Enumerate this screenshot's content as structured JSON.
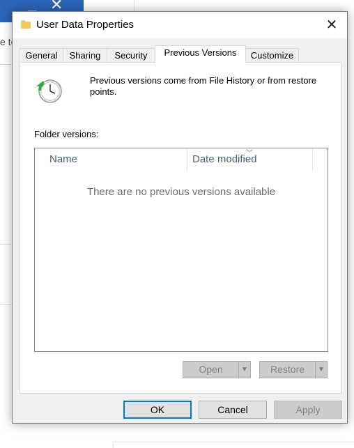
{
  "background": {
    "edge_text": "e to"
  },
  "dialog": {
    "title": "User Data Properties",
    "close_glyph": "✕",
    "tabs": [
      {
        "label": "General"
      },
      {
        "label": "Sharing"
      },
      {
        "label": "Security"
      },
      {
        "label": "Previous Versions",
        "active": true
      },
      {
        "label": "Customize"
      }
    ],
    "intro_text": "Previous versions come from File History or from restore points.",
    "folder_versions_label": "Folder versions:",
    "list": {
      "columns": [
        {
          "label": "Name"
        },
        {
          "label": "Date modified"
        }
      ],
      "empty_message": "There are no previous versions available"
    },
    "open_button": {
      "label": "Open",
      "enabled": false
    },
    "restore_button": {
      "label": "Restore",
      "enabled": false
    },
    "buttons": {
      "ok": "OK",
      "cancel": "Cancel",
      "apply": "Apply"
    },
    "colors": {
      "default_button_border": "#0078d7",
      "column_header_text": "#4c607a",
      "clock_arrow": "#2fae3c"
    }
  }
}
